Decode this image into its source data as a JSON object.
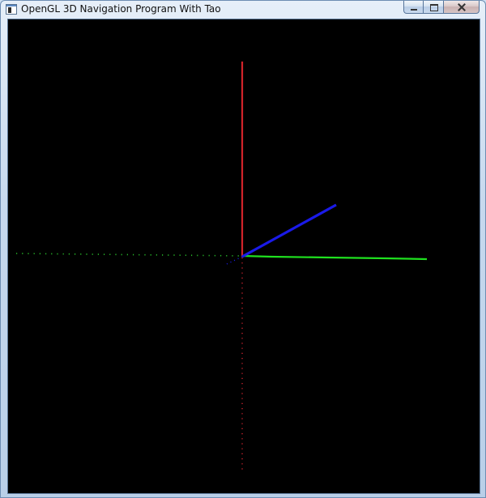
{
  "window": {
    "title": "OpenGL 3D Navigation Program With Tao",
    "icon": "application-window-icon"
  },
  "title_bar_buttons": {
    "minimize": "minimize-icon",
    "maximize": "maximize-icon",
    "close": "close-icon"
  },
  "scene": {
    "background_color": "#000000",
    "axes": {
      "y_axis_color": "#d2232a",
      "x_axis_color": "#1fe11f",
      "z_axis_color": "#1a1ae8",
      "positive_axes_style": "solid",
      "negative_axes_style": "dotted"
    }
  }
}
